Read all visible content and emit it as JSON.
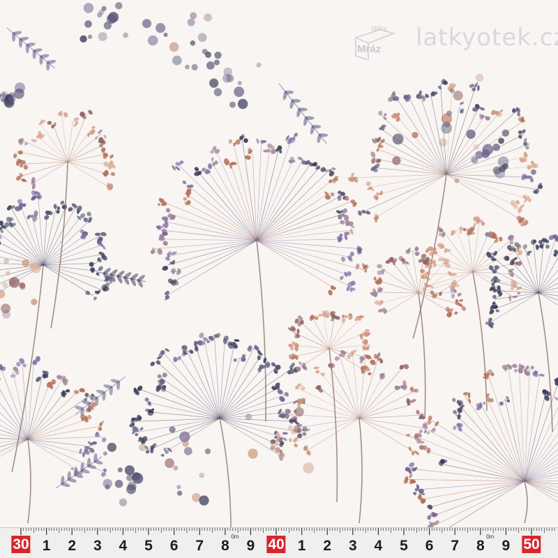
{
  "photo": {
    "subject": "fabric with watercolor dried umbel flowers pattern",
    "colors": {
      "background": "#f8f5f2",
      "navy": "#2c2f4e",
      "violet": "#6b5a8c",
      "rust": "#b06a52",
      "mauve": "#9a7a92",
      "stem": "#8a6a62"
    }
  },
  "watermark": {
    "logo_top": "látky",
    "logo_bottom": "Mráz",
    "site": "latkyotek.cz"
  },
  "ruler": {
    "labels": [
      "30",
      "1",
      "2",
      "3",
      "4",
      "5",
      "6",
      "7",
      "8",
      "9",
      "40",
      "1",
      "2",
      "3",
      "4",
      "5",
      "6",
      "7",
      "8",
      "9",
      "50"
    ],
    "highlighted": [
      "30",
      "40",
      "50"
    ],
    "small_marks": [
      "0m",
      "0m"
    ]
  }
}
